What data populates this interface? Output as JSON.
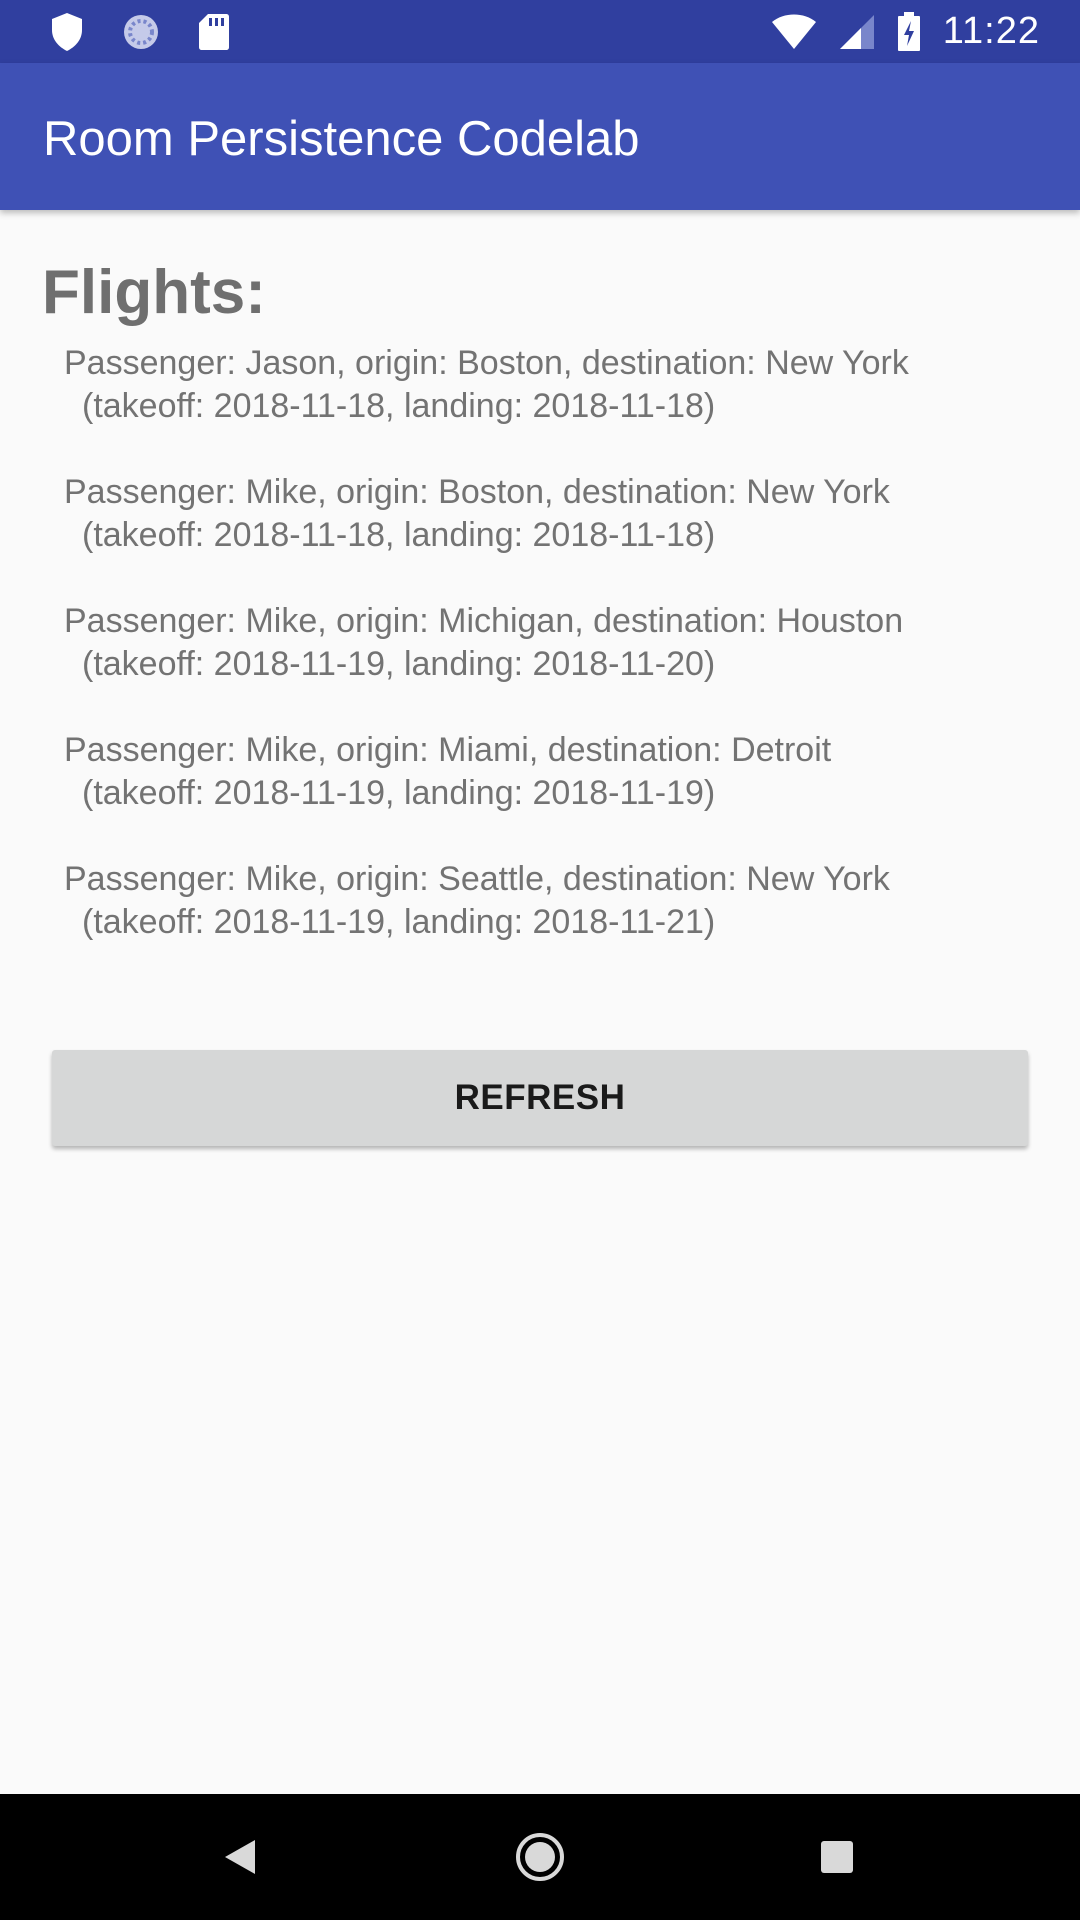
{
  "status_bar": {
    "time": "11:22",
    "icons": [
      "shield-icon",
      "sync-icon",
      "sd-card-icon",
      "wifi-icon",
      "signal-icon",
      "battery-charging-icon"
    ]
  },
  "app_bar": {
    "title": "Room Persistence Codelab",
    "color": "#3f51b5",
    "status_color": "#303f9f"
  },
  "main": {
    "heading": "Flights:",
    "flights": [
      {
        "line1": "Passenger: Jason, origin: Boston, destination: New York",
        "line2": "(takeoff: 2018-11-18, landing: 2018-11-18)"
      },
      {
        "line1": "Passenger: Mike, origin: Boston, destination: New York",
        "line2": "(takeoff: 2018-11-18, landing: 2018-11-18)"
      },
      {
        "line1": "Passenger: Mike, origin: Michigan, destination: Houston",
        "line2": "(takeoff: 2018-11-19, landing: 2018-11-20)"
      },
      {
        "line1": "Passenger: Mike, origin: Miami, destination: Detroit",
        "line2": "(takeoff: 2018-11-19, landing: 2018-11-19)"
      },
      {
        "line1": "Passenger: Mike, origin: Seattle, destination: New York",
        "line2": "(takeoff: 2018-11-19, landing: 2018-11-21)"
      }
    ],
    "refresh_label": "REFRESH"
  },
  "nav_bar": {
    "icons": [
      "back-icon",
      "home-icon",
      "recents-icon"
    ]
  }
}
